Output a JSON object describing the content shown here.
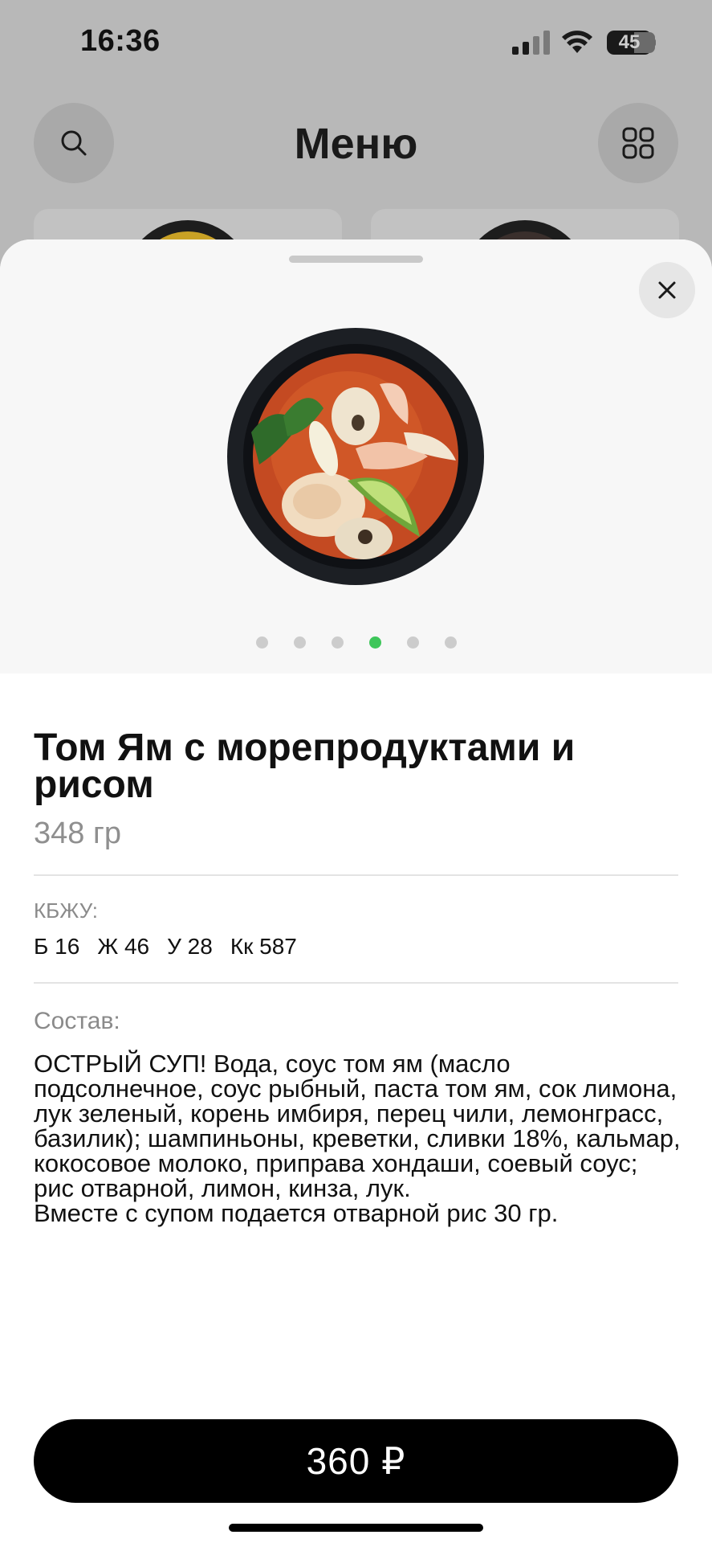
{
  "status_bar": {
    "time": "16:36",
    "battery": "45",
    "icons": [
      "signal-icon",
      "wifi-icon",
      "battery-icon"
    ]
  },
  "header": {
    "title": "Меню",
    "left_icon": "search-icon",
    "right_icon": "qr-grid-icon"
  },
  "sheet": {
    "close_icon": "close-icon",
    "gallery": {
      "total": 6,
      "active_index": 3,
      "accent": "#3ec65a"
    },
    "dish": {
      "title": "Том Ям с морепродуктами и рисом",
      "weight": "348 гр"
    },
    "nutrition": {
      "label": "КБЖУ:",
      "items": [
        "Б 16",
        "Ж 46",
        "У 28",
        "Кк 587"
      ]
    },
    "composition": {
      "label": "Состав:",
      "text": "ОСТРЫЙ СУП! Вода, соус том ям (масло подсолнечное, соус рыбный, паста том ям, сок лимона, лук зеленый, корень имбиря, перец чили, лемонграсс, базилик); шампиньоны, креветки, сливки 18%, кальмар, кокосовое молоко, приправа хондаши, соевый соус; рис отварной, лимон, кинза, лук.\nВместе с супом подается отварной рис 30 гр."
    },
    "price_button": "360 ₽"
  }
}
